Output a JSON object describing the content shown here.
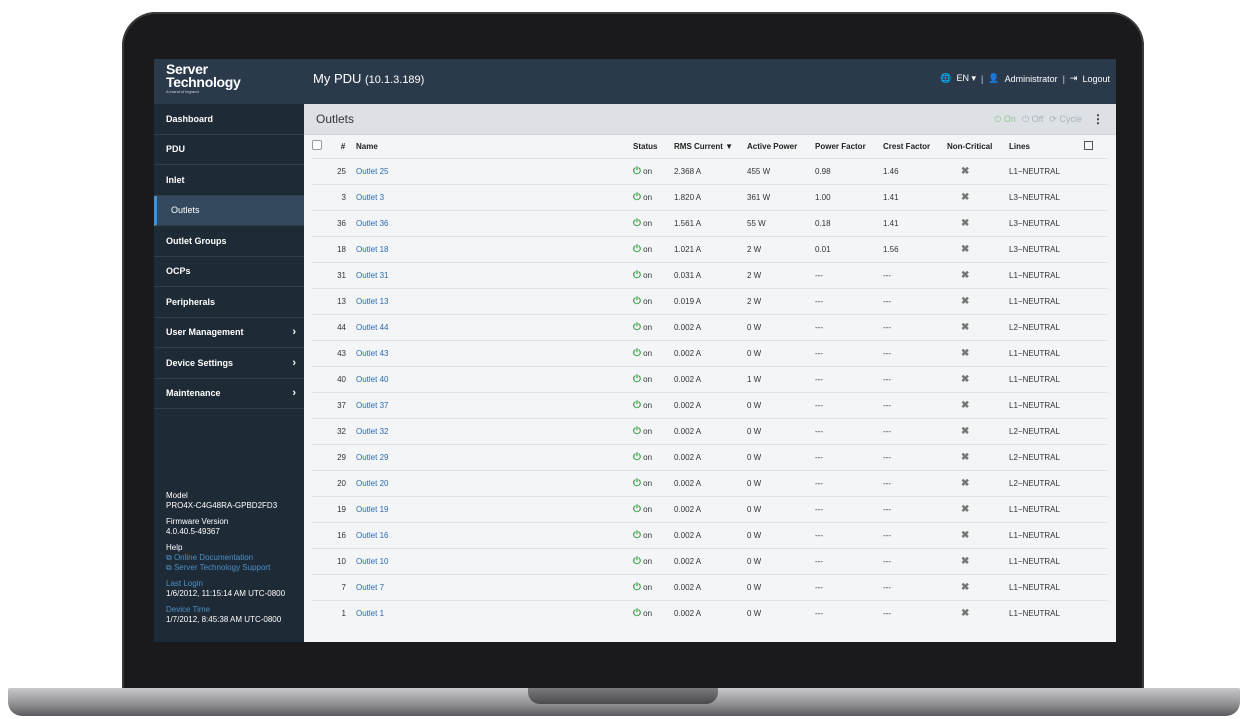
{
  "header": {
    "logo_line1": "Server",
    "logo_line2": "Technology",
    "logo_sub": "A brand of legrand",
    "title": "My PDU",
    "ip": "(10.1.3.189)",
    "language": "EN",
    "user": "Administrator",
    "logout": "Logout"
  },
  "sidebar": {
    "items": [
      {
        "label": "Dashboard"
      },
      {
        "label": "PDU"
      },
      {
        "label": "Inlet"
      },
      {
        "label": "Outlets"
      },
      {
        "label": "Outlet Groups"
      },
      {
        "label": "OCPs"
      },
      {
        "label": "Peripherals"
      },
      {
        "label": "User Management"
      },
      {
        "label": "Device Settings"
      },
      {
        "label": "Maintenance"
      }
    ],
    "model_label": "Model",
    "model_value": "PRO4X-C4G48RA-GPBD2FD3",
    "firmware_label": "Firmware Version",
    "firmware_value": "4.0.40.5-49367",
    "help_label": "Help",
    "help_doc": "Online Documentation",
    "help_support": "Server Technology Support",
    "last_login_label": "Last Login",
    "last_login_value": "1/6/2012, 11:15:14 AM UTC-0800",
    "device_time_label": "Device Time",
    "device_time_value": "1/7/2012, 8:45:38 AM UTC-0800"
  },
  "main": {
    "title": "Outlets",
    "action_on": "On",
    "action_off": "Off",
    "action_cycle": "Cycle"
  },
  "table": {
    "columns": [
      "#",
      "Name",
      "Status",
      "RMS Current ▼",
      "Active Power",
      "Power Factor",
      "Crest Factor",
      "Non-Critical",
      "Lines"
    ],
    "rows": [
      {
        "num": "25",
        "name": "Outlet 25",
        "status": "on",
        "rms": "2.368 A",
        "power": "455 W",
        "pf": "0.98",
        "cf": "1.46",
        "line": "L1−NEUTRAL"
      },
      {
        "num": "3",
        "name": "Outlet 3",
        "status": "on",
        "rms": "1.820 A",
        "power": "361 W",
        "pf": "1.00",
        "cf": "1.41",
        "line": "L3−NEUTRAL"
      },
      {
        "num": "36",
        "name": "Outlet 36",
        "status": "on",
        "rms": "1.561 A",
        "power": "55 W",
        "pf": "0.18",
        "cf": "1.41",
        "line": "L3−NEUTRAL"
      },
      {
        "num": "18",
        "name": "Outlet 18",
        "status": "on",
        "rms": "1.021 A",
        "power": "2 W",
        "pf": "0.01",
        "cf": "1.56",
        "line": "L3−NEUTRAL"
      },
      {
        "num": "31",
        "name": "Outlet 31",
        "status": "on",
        "rms": "0.031 A",
        "power": "2 W",
        "pf": "---",
        "cf": "---",
        "line": "L1−NEUTRAL"
      },
      {
        "num": "13",
        "name": "Outlet 13",
        "status": "on",
        "rms": "0.019 A",
        "power": "2 W",
        "pf": "---",
        "cf": "---",
        "line": "L1−NEUTRAL"
      },
      {
        "num": "44",
        "name": "Outlet 44",
        "status": "on",
        "rms": "0.002 A",
        "power": "0 W",
        "pf": "---",
        "cf": "---",
        "line": "L2−NEUTRAL"
      },
      {
        "num": "43",
        "name": "Outlet 43",
        "status": "on",
        "rms": "0.002 A",
        "power": "0 W",
        "pf": "---",
        "cf": "---",
        "line": "L1−NEUTRAL"
      },
      {
        "num": "40",
        "name": "Outlet 40",
        "status": "on",
        "rms": "0.002 A",
        "power": "1 W",
        "pf": "---",
        "cf": "---",
        "line": "L1−NEUTRAL"
      },
      {
        "num": "37",
        "name": "Outlet 37",
        "status": "on",
        "rms": "0.002 A",
        "power": "0 W",
        "pf": "---",
        "cf": "---",
        "line": "L1−NEUTRAL"
      },
      {
        "num": "32",
        "name": "Outlet 32",
        "status": "on",
        "rms": "0.002 A",
        "power": "0 W",
        "pf": "---",
        "cf": "---",
        "line": "L2−NEUTRAL"
      },
      {
        "num": "29",
        "name": "Outlet 29",
        "status": "on",
        "rms": "0.002 A",
        "power": "0 W",
        "pf": "---",
        "cf": "---",
        "line": "L2−NEUTRAL"
      },
      {
        "num": "20",
        "name": "Outlet 20",
        "status": "on",
        "rms": "0.002 A",
        "power": "0 W",
        "pf": "---",
        "cf": "---",
        "line": "L2−NEUTRAL"
      },
      {
        "num": "19",
        "name": "Outlet 19",
        "status": "on",
        "rms": "0.002 A",
        "power": "0 W",
        "pf": "---",
        "cf": "---",
        "line": "L1−NEUTRAL"
      },
      {
        "num": "16",
        "name": "Outlet 16",
        "status": "on",
        "rms": "0.002 A",
        "power": "0 W",
        "pf": "---",
        "cf": "---",
        "line": "L1−NEUTRAL"
      },
      {
        "num": "10",
        "name": "Outlet 10",
        "status": "on",
        "rms": "0.002 A",
        "power": "0 W",
        "pf": "---",
        "cf": "---",
        "line": "L1−NEUTRAL"
      },
      {
        "num": "7",
        "name": "Outlet 7",
        "status": "on",
        "rms": "0.002 A",
        "power": "0 W",
        "pf": "---",
        "cf": "---",
        "line": "L1−NEUTRAL"
      },
      {
        "num": "1",
        "name": "Outlet 1",
        "status": "on",
        "rms": "0.002 A",
        "power": "0 W",
        "pf": "---",
        "cf": "---",
        "line": "L1−NEUTRAL"
      }
    ]
  },
  "colors": {
    "topbar": "#2b3a4a",
    "sidebar": "#1e2a36",
    "link": "#2a6bb0",
    "status_on": "#37a24a"
  }
}
